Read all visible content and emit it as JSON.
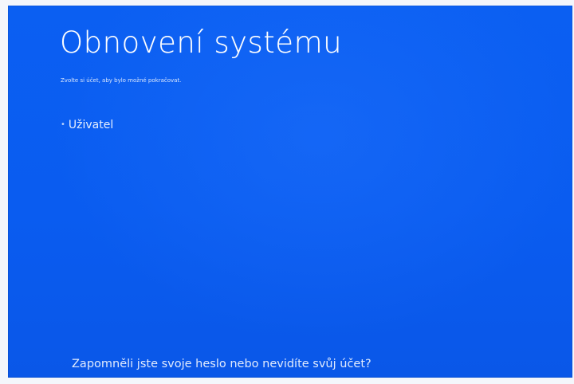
{
  "screen": {
    "title": "Obnovení systému",
    "subtitle": "Zvolte si účet, aby bylo možné pokračovat.",
    "accounts": [
      {
        "label": "Uživatel",
        "bullet_icon": "bullet-icon"
      }
    ],
    "forgot_link": "Zapomněli jste svoje heslo nebo nevidíte svůj účet?",
    "background_color": "#0a5cf0",
    "text_color": "#ffffff"
  }
}
